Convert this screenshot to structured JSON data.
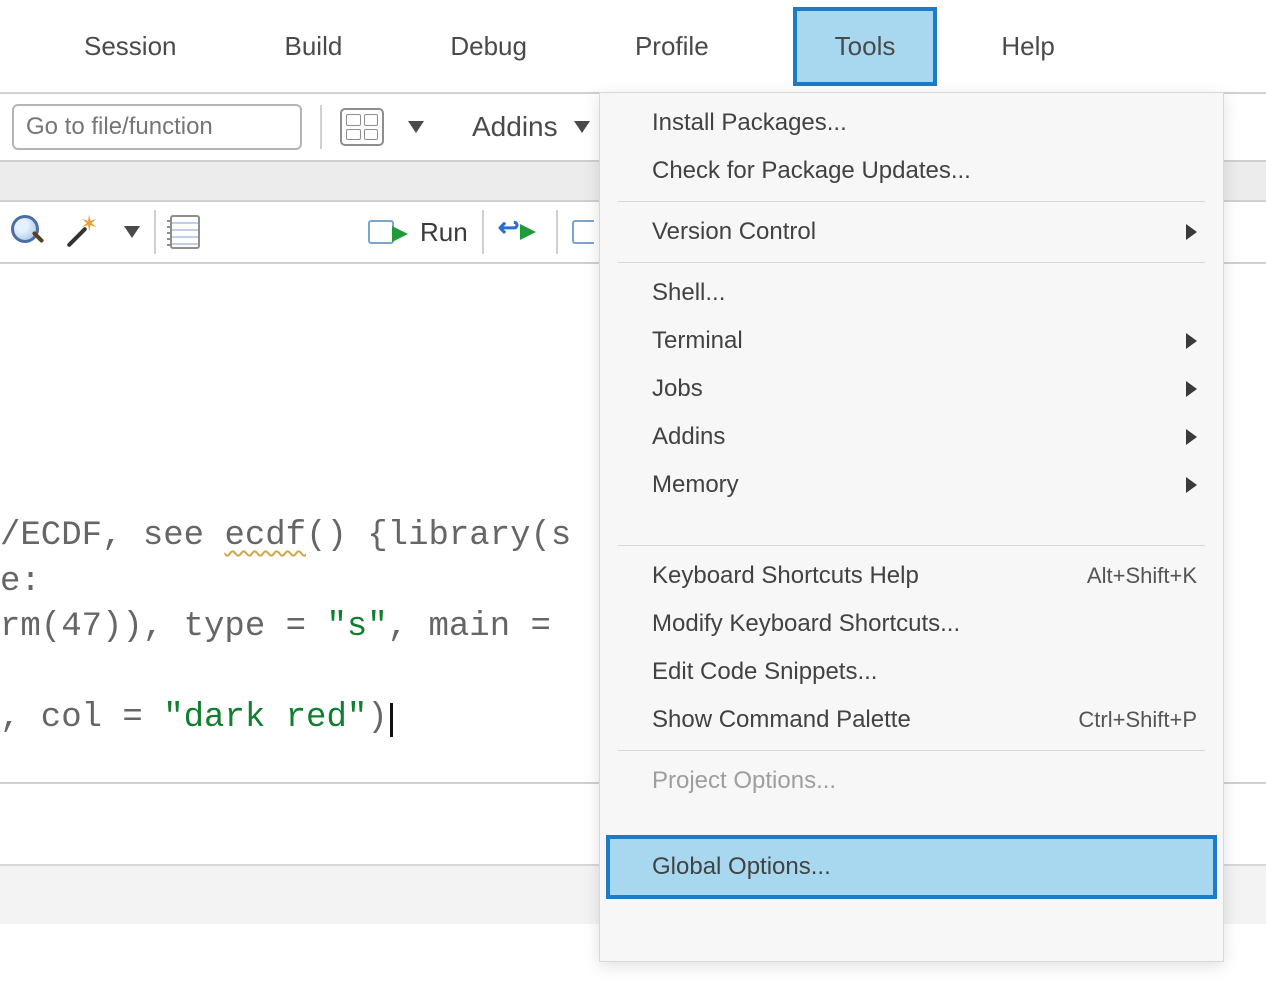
{
  "menu": {
    "session": "Session",
    "build": "Build",
    "debug": "Debug",
    "profile": "Profile",
    "tools": "Tools",
    "help": "Help"
  },
  "toolbar2": {
    "goto_placeholder": "Go to file/function",
    "addins_label": "Addins"
  },
  "toolbar3": {
    "run_label": "Run"
  },
  "editor": {
    "line1_a": "/ECDF, see ",
    "line1_ecdf": "ecdf",
    "line1_b": "() {library(s",
    "line2": "e:",
    "line3_a": "rm(47)), type = ",
    "line3_s": "\"s\"",
    "line3_b": ", main = ",
    "line4_a": ", col = ",
    "line4_s": "\"dark red\"",
    "line4_b": ")"
  },
  "tools_menu": {
    "install_packages": "Install Packages...",
    "check_updates": "Check for Package Updates...",
    "version_control": "Version Control",
    "shell": "Shell...",
    "terminal": "Terminal",
    "jobs": "Jobs",
    "addins": "Addins",
    "memory": "Memory",
    "kb_help": "Keyboard Shortcuts Help",
    "kb_help_sc": "Alt+Shift+K",
    "modify_kb": "Modify Keyboard Shortcuts...",
    "edit_snippets": "Edit Code Snippets...",
    "cmd_palette": "Show Command Palette",
    "cmd_palette_sc": "Ctrl+Shift+P",
    "project_options": "Project Options...",
    "global_options": "Global Options..."
  }
}
